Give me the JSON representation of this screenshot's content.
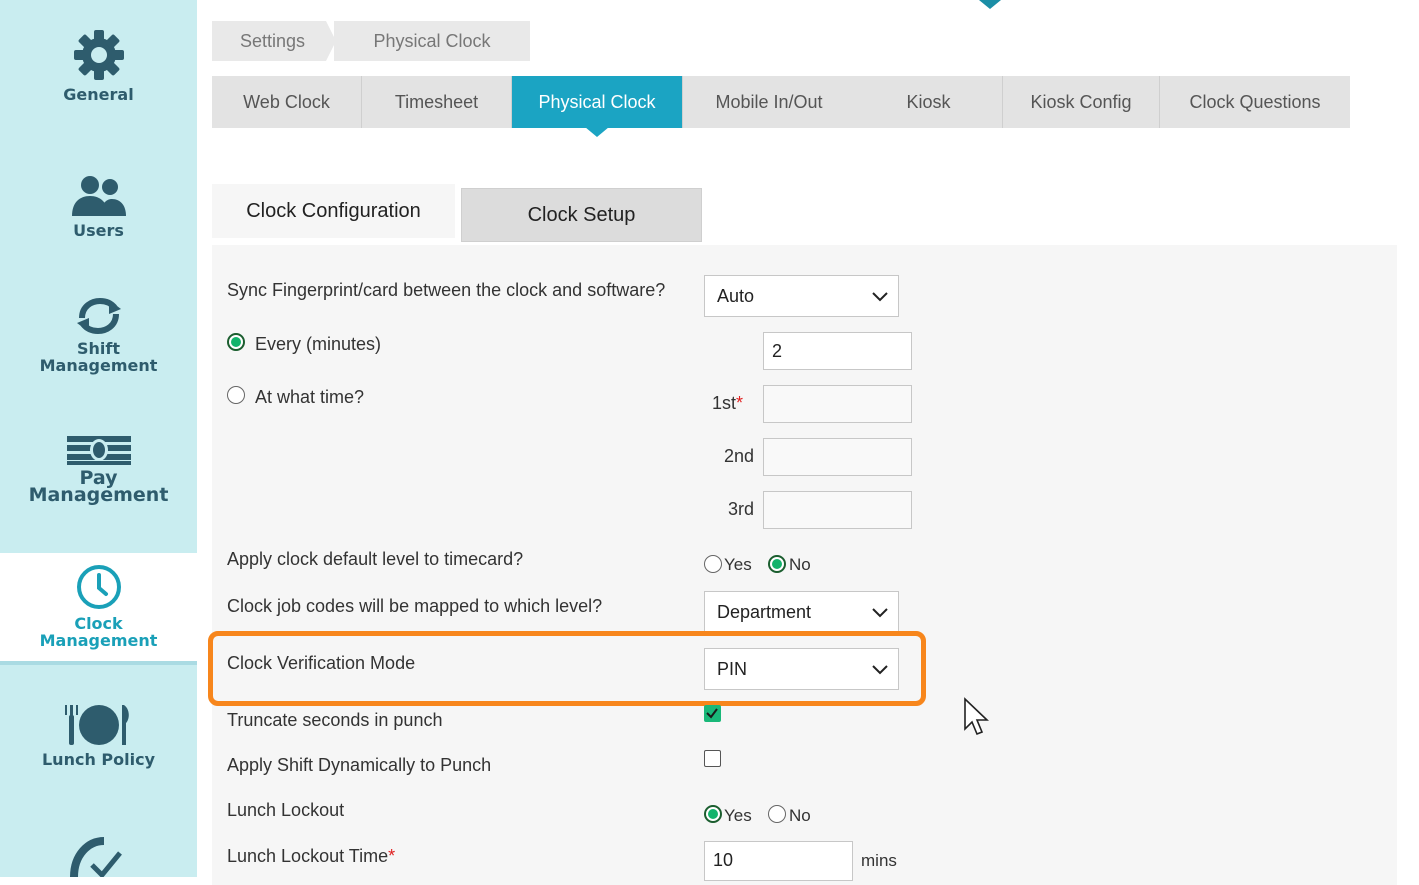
{
  "sidebar": {
    "items": [
      {
        "label_1": "General",
        "label_2": "",
        "icon": "gear-icon"
      },
      {
        "label_1": "Users",
        "label_2": "",
        "icon": "users-icon"
      },
      {
        "label_1": "Shift",
        "label_2": "Management",
        "icon": "refresh-icon"
      },
      {
        "label_1": "Pay",
        "label_2": "Management",
        "icon": "money-icon"
      },
      {
        "label_1": "Clock",
        "label_2": "Management",
        "icon": "clock-icon"
      },
      {
        "label_1": "Lunch Policy",
        "label_2": "",
        "icon": "lunch-icon"
      }
    ]
  },
  "breadcrumb": {
    "items": [
      "Settings",
      "Physical Clock"
    ]
  },
  "tabs": [
    "Web Clock",
    "Timesheet",
    "Physical Clock",
    "Mobile In/Out",
    "Kiosk",
    "Kiosk Config",
    "Clock Questions"
  ],
  "active_tab": "Physical Clock",
  "subtabs": [
    "Clock Configuration",
    "Clock Setup"
  ],
  "form": {
    "sync_label": "Sync Fingerprint/card between the clock and software?",
    "sync_value": "Auto",
    "every_label": "Every (minutes)",
    "every_value": "2",
    "at_time_label": "At what time?",
    "first_label": "1st",
    "second_label": "2nd",
    "third_label": "3rd",
    "required_mark": "*",
    "apply_default_label": "Apply clock default level to timecard?",
    "yes": "Yes",
    "no": "No",
    "job_codes_label": "Clock job codes will be mapped to which level?",
    "job_codes_value": "Department",
    "verification_label": "Clock Verification Mode",
    "verification_value": "PIN",
    "truncate_label": "Truncate seconds in punch",
    "apply_shift_label": "Apply Shift Dynamically to Punch",
    "lunch_lockout_label": "Lunch Lockout",
    "lunch_lockout_time_label": "Lunch Lockout Time",
    "lunch_lockout_time_value": "10",
    "mins": "mins"
  },
  "colors": {
    "accent": "#1ba4c3",
    "highlight": "#f7861c",
    "sidebar": "#c9edf0"
  }
}
